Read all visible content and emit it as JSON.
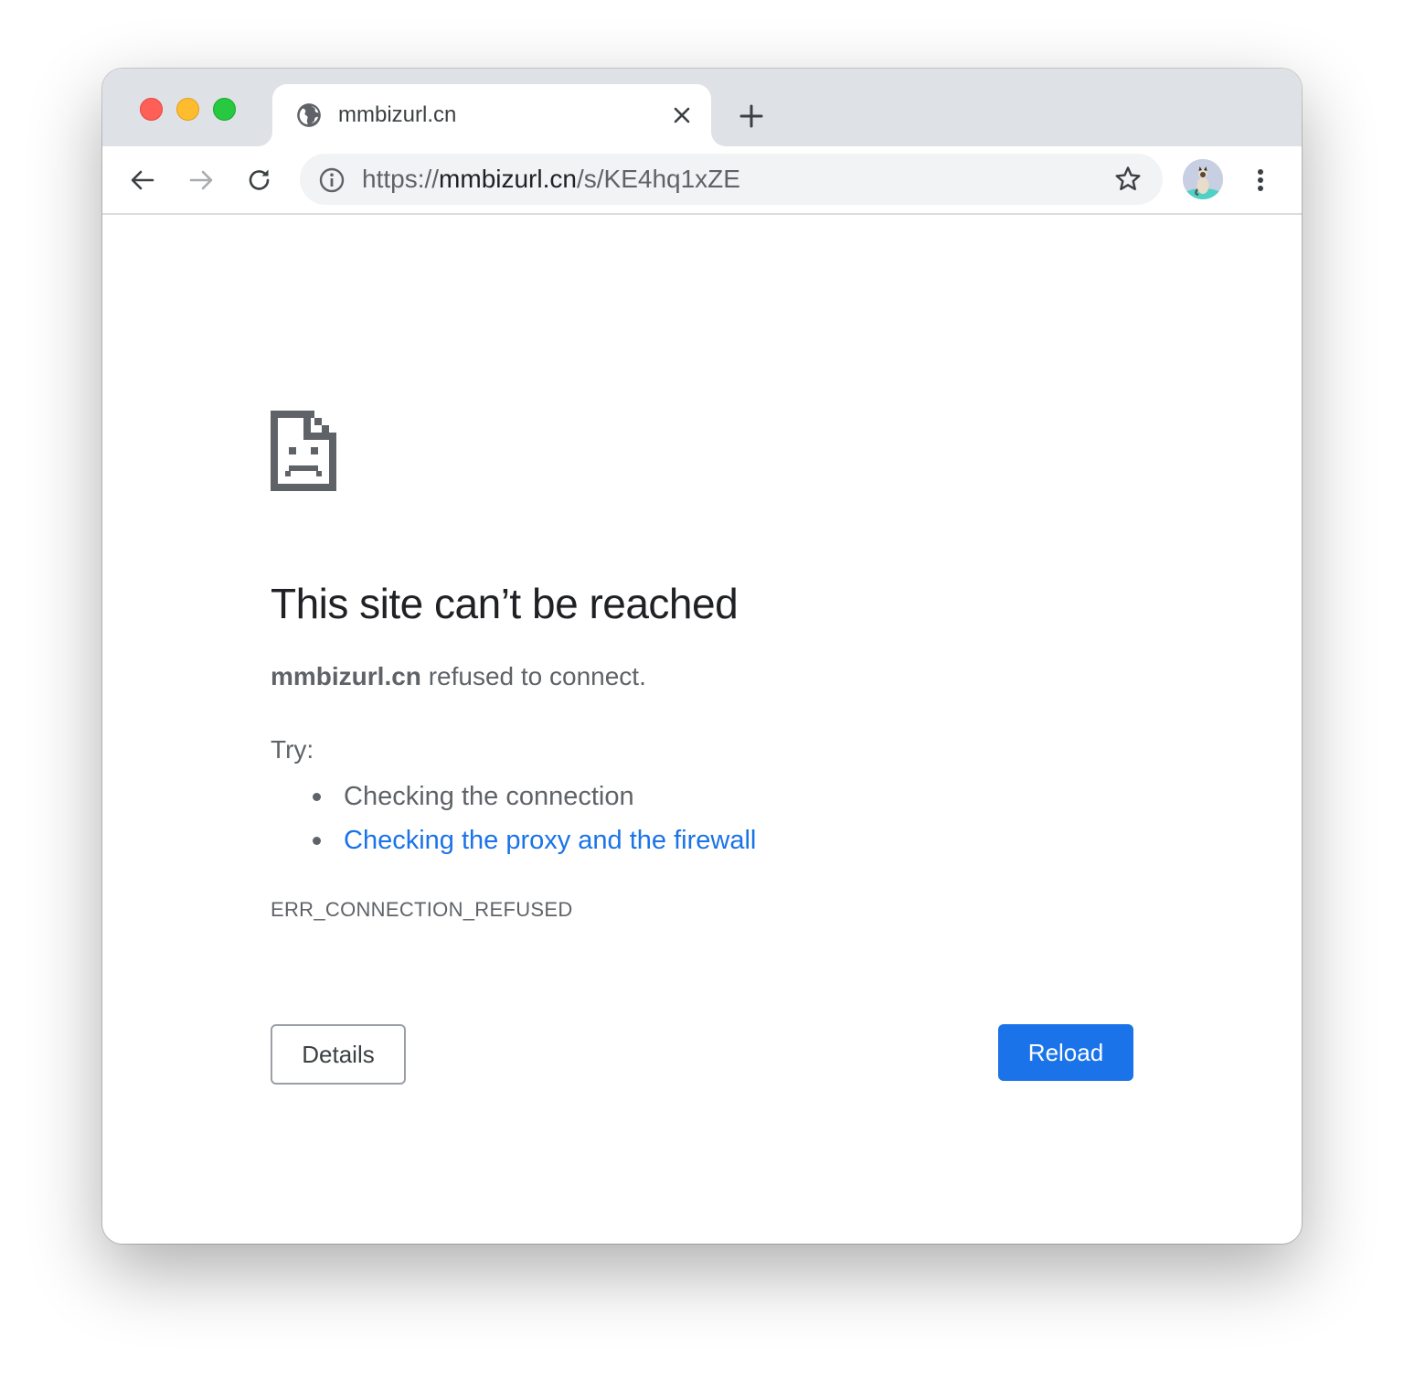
{
  "window": {
    "traffic_lights": {
      "close": "#fe5f57",
      "minimize": "#febc2e",
      "maximize": "#28c840"
    }
  },
  "tab": {
    "title": "mmbizurl.cn",
    "favicon": "globe-icon"
  },
  "toolbar": {
    "back_icon": "arrow-left-icon",
    "forward_icon": "arrow-right-icon",
    "reload_icon": "reload-icon",
    "menu_icon": "kebab-menu-icon"
  },
  "omnibox": {
    "scheme": "https://",
    "host": "mmbizurl.cn",
    "path": "/s/KE4hq1xZE",
    "info_icon": "info-icon",
    "bookmark_icon": "star-icon"
  },
  "error_page": {
    "icon": "sad-page-icon",
    "headline": "This site can’t be reached",
    "host": "mmbizurl.cn",
    "summary_suffix": " refused to connect.",
    "try_label": "Try:",
    "suggestions": [
      {
        "text": "Checking the connection",
        "is_link": false
      },
      {
        "text": "Checking the proxy and the firewall",
        "is_link": true
      }
    ],
    "error_code": "ERR_CONNECTION_REFUSED",
    "details_label": "Details",
    "reload_label": "Reload"
  },
  "colors": {
    "accent": "#1a73e8",
    "titlebar": "#dee1e6",
    "omnibox": "#f1f3f4",
    "text_primary": "#202124",
    "text_secondary": "#5f6368"
  }
}
